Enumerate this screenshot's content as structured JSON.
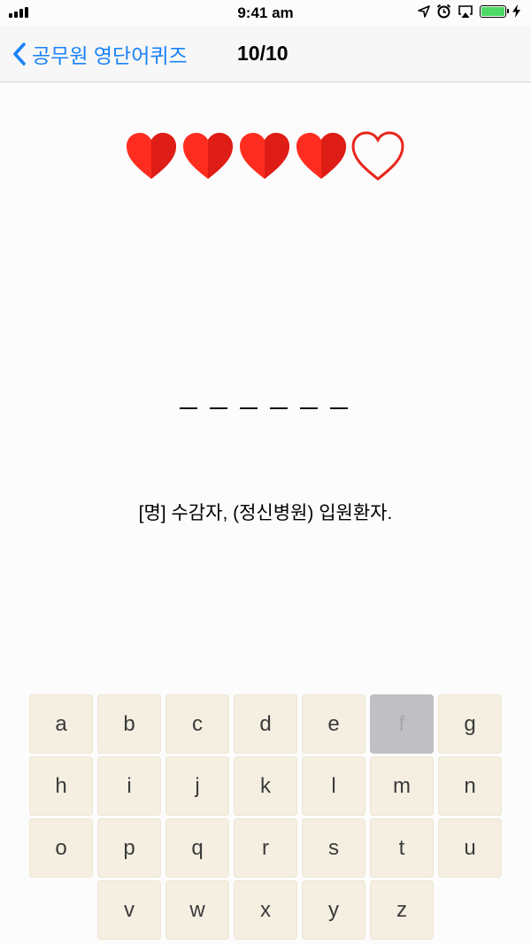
{
  "status_bar": {
    "time": "9:41 am",
    "battery_color": "#4cd964"
  },
  "nav": {
    "back_label": "공무원 영단어퀴즈",
    "title": "10/10",
    "accent_color": "#1a82f7"
  },
  "hearts": {
    "total": 5,
    "filled": 4,
    "color": "#e8261c"
  },
  "answer": {
    "blank_count": 6
  },
  "definition": "[명] 수감자, (정신병원) 입원환자.",
  "keyboard": {
    "rows": [
      [
        "a",
        "b",
        "c",
        "d",
        "e",
        "f",
        "g"
      ],
      [
        "h",
        "i",
        "j",
        "k",
        "l",
        "m",
        "n"
      ],
      [
        "o",
        "p",
        "q",
        "r",
        "s",
        "t",
        "u"
      ],
      [
        "v",
        "w",
        "x",
        "y",
        "z"
      ]
    ],
    "used_keys": [
      "f"
    ]
  }
}
